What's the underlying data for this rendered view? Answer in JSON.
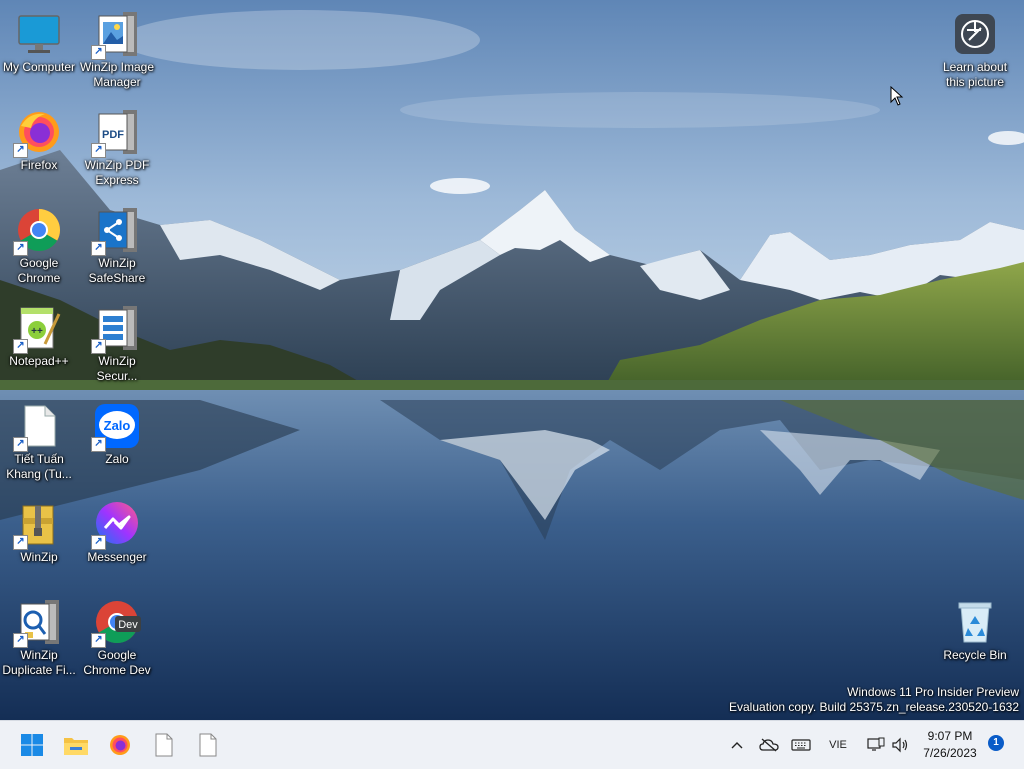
{
  "desktop": {
    "icons": [
      {
        "label": "My Computer",
        "icon": "monitor-icon"
      },
      {
        "label": "WinZip Image Manager",
        "icon": "winzip-image-manager-icon"
      },
      {
        "label": "Firefox",
        "icon": "firefox-icon"
      },
      {
        "label": "WinZip PDF Express",
        "icon": "winzip-pdf-express-icon"
      },
      {
        "label": "Google Chrome",
        "icon": "chrome-icon"
      },
      {
        "label": "WinZip SafeShare",
        "icon": "winzip-safeshare-icon"
      },
      {
        "label": "Notepad++",
        "icon": "notepad-plus-plus-icon"
      },
      {
        "label": "WinZip Secur...",
        "icon": "winzip-secure-backup-icon"
      },
      {
        "label": "Tiết Tuấn Khang (Tu...",
        "icon": "document-icon"
      },
      {
        "label": "Zalo",
        "icon": "zalo-icon"
      },
      {
        "label": "WinZip",
        "icon": "winzip-icon"
      },
      {
        "label": "Messenger",
        "icon": "messenger-icon"
      },
      {
        "label": "WinZip Duplicate Fi...",
        "icon": "winzip-duplicate-finder-icon"
      },
      {
        "label": "Google Chrome Dev",
        "icon": "chrome-dev-icon"
      }
    ],
    "learn_about": {
      "label": "Learn about this picture",
      "icon": "camera-icon"
    },
    "recycle_bin": {
      "label": "Recycle Bin",
      "icon": "recycle-bin-icon"
    },
    "watermark": {
      "line1": "Windows 11 Pro Insider Preview",
      "line2": "Evaluation copy. Build 25375.zn_release.230520-1632"
    }
  },
  "taskbar": {
    "pinned": [
      "start-icon",
      "file-explorer-icon",
      "firefox-icon",
      "blank-document-icon",
      "blank-document-icon"
    ],
    "tray": {
      "chevron": "chevron-up-icon",
      "onedrive": "onedrive-offline-icon",
      "keyboard": "keyboard-icon",
      "language": "VIE",
      "network": "network-icon",
      "volume": "volume-icon"
    },
    "clock": {
      "time": "9:07 PM",
      "date": "7/26/2023"
    },
    "notifications": "1"
  },
  "chrome_dev_badge": "Dev",
  "zalo_text": "Zalo",
  "pdf_text": "PDF"
}
